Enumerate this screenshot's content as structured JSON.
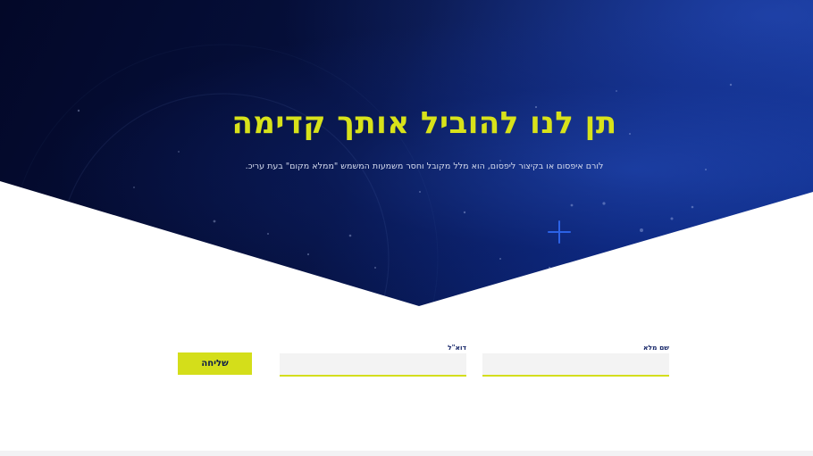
{
  "hero": {
    "title": "תן לנו להוביל אותך קדימה",
    "subtitle": "לורם איפסום או בקיצור ליפסום, הוא מלל מקובל וחסר משמעות המשמש \"ממלא מקום\" בעת עריכ.",
    "decor_icon": "plus-icon"
  },
  "form": {
    "full_name_label": "שם מלא",
    "full_name_value": "",
    "email_label": "דוא\"ל",
    "email_value": "",
    "submit_label": "שליחה"
  },
  "colors": {
    "accent": "#d4de1a",
    "hero_dark": "#030828",
    "hero_blue": "#10318f",
    "label": "#1a2a6b"
  }
}
